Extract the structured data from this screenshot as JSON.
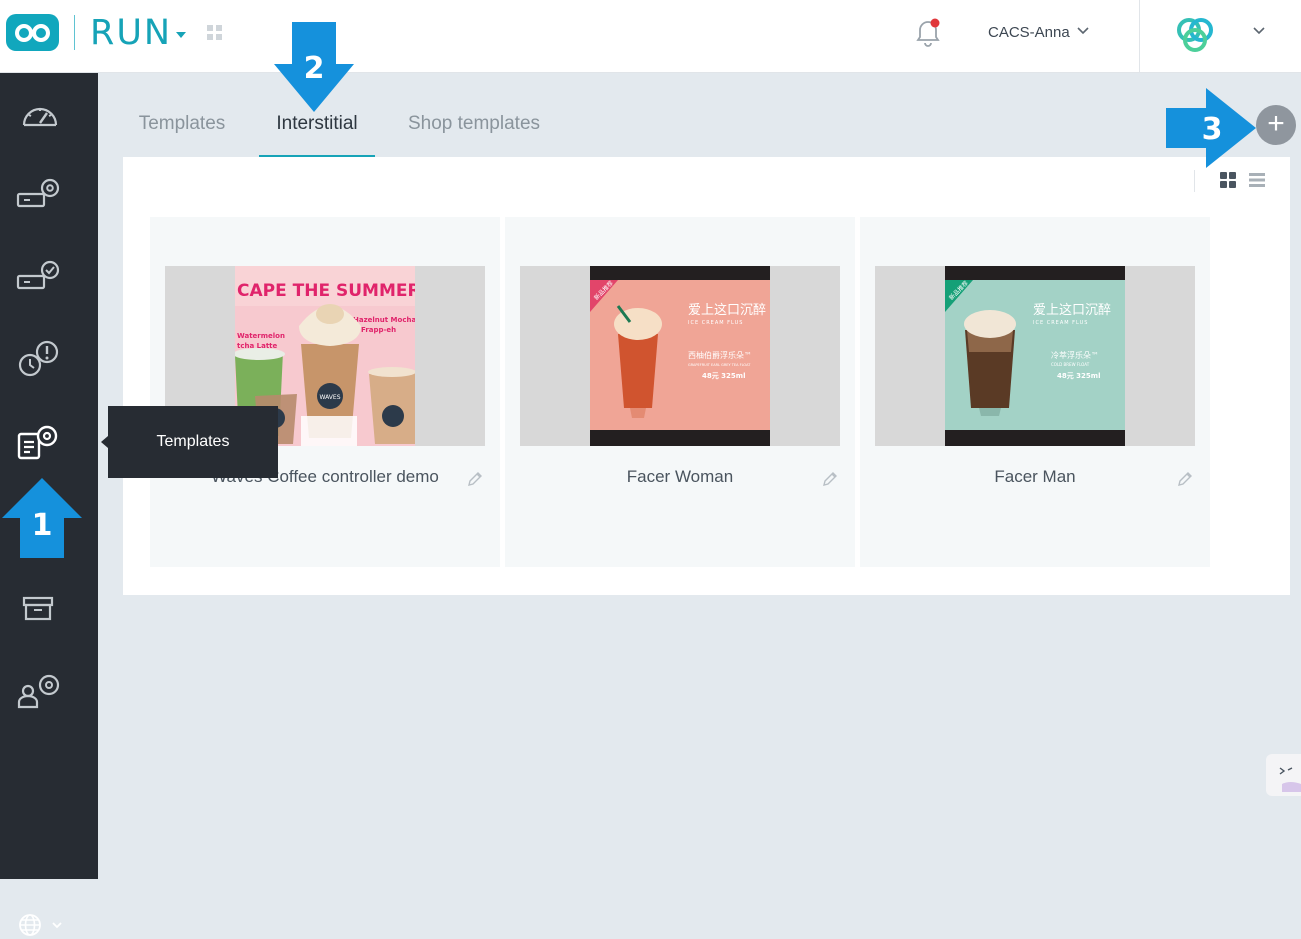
{
  "header": {
    "app_name": "RUN",
    "user_name": "CACS-Anna"
  },
  "sidebar": {
    "items": [
      {
        "name": "dashboard-icon"
      },
      {
        "name": "device-settings-icon"
      },
      {
        "name": "device-check-icon"
      },
      {
        "name": "alert-icon"
      },
      {
        "name": "templates-icon"
      },
      {
        "name": "archive-icon"
      },
      {
        "name": "user-settings-icon"
      }
    ],
    "tooltip": "Templates"
  },
  "tabs": [
    {
      "label": "Templates",
      "active": false
    },
    {
      "label": "Interstitial",
      "active": true
    },
    {
      "label": "Shop templates",
      "active": false
    }
  ],
  "cards": [
    {
      "name": "Waves Coffee controller demo"
    },
    {
      "name": "Facer Woman"
    },
    {
      "name": "Facer Man"
    }
  ],
  "thumbnail_text": {
    "summer": "CAPE THE SUMMER H",
    "hazelnut": "Hazelnut Mocha Frapp-eh",
    "watermelon": "Watermelon Matcha Latte",
    "waves": "WAVES",
    "zh_title": "爱上这口沉醉",
    "en_sub": "ICE CREAM FLUS",
    "woman_drink": "西柚伯爵浮乐朵™",
    "woman_drink_en": "GRAPEFRUIT EARL GREY TEA FLOAT",
    "woman_price": "48元 325ml",
    "man_drink": "冷萃浮乐朵™",
    "man_drink_en": "COLD BREW FLOAT",
    "man_price": "48元 325ml",
    "badge": "新品推荐"
  },
  "annotations": [
    "1",
    "2",
    "3"
  ],
  "colors": {
    "accent": "#16a3b7",
    "sidebar": "#272c33",
    "annotation": "#1591dc"
  }
}
